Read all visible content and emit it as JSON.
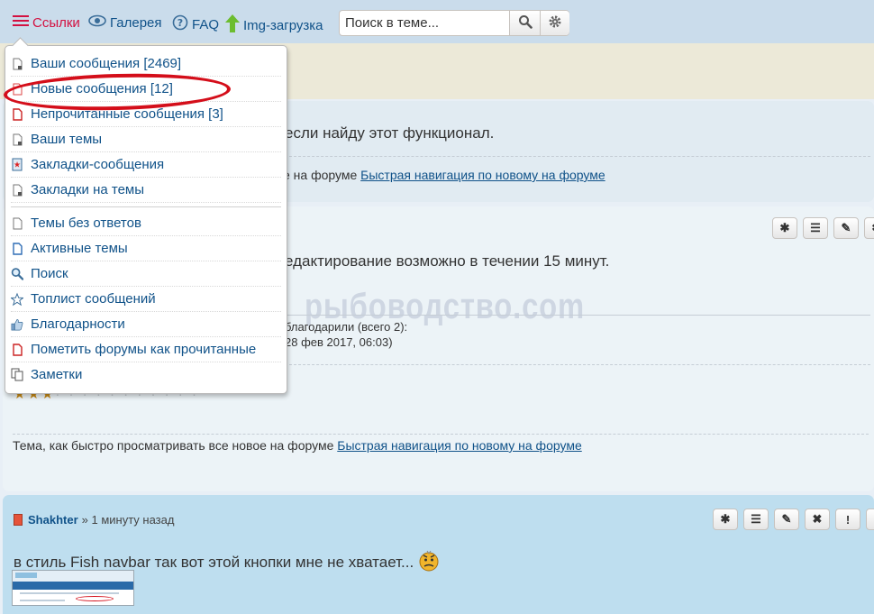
{
  "nav": {
    "links_label": "Ссылки",
    "gallery_label": "Галерея",
    "faq_label": "FAQ",
    "img_label": "Img-загрузка",
    "search_placeholder": "Поиск в теме..."
  },
  "dropdown": {
    "items": [
      {
        "label": "Ваши сообщения [2469]",
        "icon": "doc-user-icon"
      },
      {
        "label": "Новые сообщения [12]",
        "icon": "doc-new-icon"
      },
      {
        "label": "Непрочитанные сообщения [3]",
        "icon": "doc-unread-icon"
      },
      {
        "label": "Ваши темы",
        "icon": "doc-user-icon"
      },
      {
        "label": "Закладки-сообщения",
        "icon": "bookmark-star-icon"
      },
      {
        "label": "Закладки на темы",
        "icon": "doc-user-icon"
      },
      {
        "label": "Темы без ответов",
        "icon": "doc-icon"
      },
      {
        "label": "Активные темы",
        "icon": "doc-active-icon"
      },
      {
        "label": "Поиск",
        "icon": "search-icon"
      },
      {
        "label": "Топлист сообщений",
        "icon": "star-icon"
      },
      {
        "label": "Благодарности",
        "icon": "thumbs-up-icon"
      },
      {
        "label": "Пометить форумы как прочитанные",
        "icon": "doc-mark-icon"
      },
      {
        "label": "Заметки",
        "icon": "notes-icon"
      }
    ]
  },
  "post1": {
    "text": "если найду этот функционал.",
    "sig_prefix": "е на форуме",
    "sig_link": "Быстрая навигация по новому на форуме"
  },
  "post2": {
    "text": "едактирование возможно в течении 15 минут.",
    "watermark": "рыбоводство.com",
    "thanks_line1": "благодарили (всего 2):",
    "thanks_line2": "28 фев 2017, 06:03)",
    "sig_prefix": "Тема, как быстро просматривать все новое на форуме",
    "sig_link": "Быстрая навигация по новому на форуме"
  },
  "post3": {
    "author": "Shakhter",
    "time": "» 1 минуту назад",
    "text": "в стиль Fish navbar так вот этой кнопки мне не хватает..."
  },
  "colors": {
    "link": "#105289",
    "highlight_ellipse": "#d40e1a",
    "navbar_bg": "#cadceb"
  }
}
